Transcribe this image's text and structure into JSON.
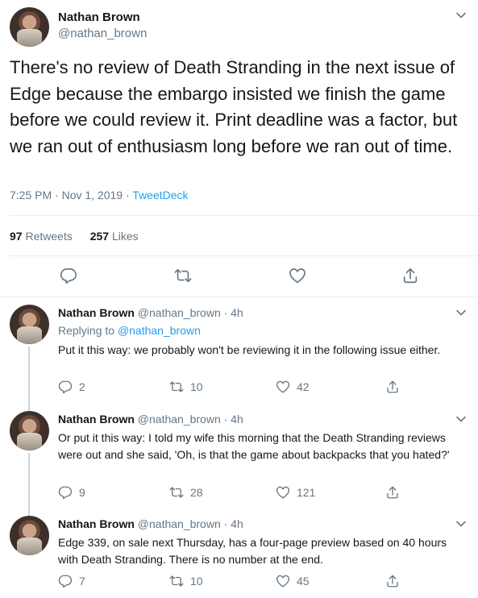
{
  "main": {
    "name": "Nathan Brown",
    "handle": "@nathan_brown",
    "text": "There's no review of Death Stranding in the next issue of Edge because the embargo insisted we finish the game before we could review it. Print deadline was a factor, but we ran out of enthusiasm long before we ran out of time.",
    "time": "7:25 PM · Nov 1, 2019 · ",
    "source": "TweetDeck",
    "retweets": "97",
    "retweets_label": "Retweets",
    "likes": "257",
    "likes_label": "Likes"
  },
  "replies": [
    {
      "name": "Nathan Brown",
      "handle": "@nathan_brown · 4h",
      "replying_prefix": "Replying to ",
      "replying_to": "@nathan_brown",
      "text": "Put it this way: we probably won't be reviewing it in the following issue either.",
      "replies": "2",
      "retweets": "10",
      "likes": "42"
    },
    {
      "name": "Nathan Brown",
      "handle": "@nathan_brown · 4h",
      "text": "Or put it this way: I told my wife this morning that the Death Stranding reviews were out and she said, 'Oh, is that the game about backpacks that you hated?'",
      "replies": "9",
      "retweets": "28",
      "likes": "121"
    },
    {
      "name": "Nathan Brown",
      "handle": "@nathan_brown · 4h",
      "text": "Edge 339, on sale next Thursday, has a four-page preview based on 40 hours with Death Stranding. There is no number at the end.",
      "replies": "7",
      "retweets": "10",
      "likes": "45"
    }
  ],
  "icons": {
    "reply": "reply-icon",
    "retweet": "retweet-icon",
    "like": "like-icon",
    "share": "share-icon",
    "more": "chevron-down-icon"
  },
  "colors": {
    "accent": "#1da1f2",
    "muted": "#657786",
    "text": "#14171a",
    "border": "#e6ecf0"
  }
}
